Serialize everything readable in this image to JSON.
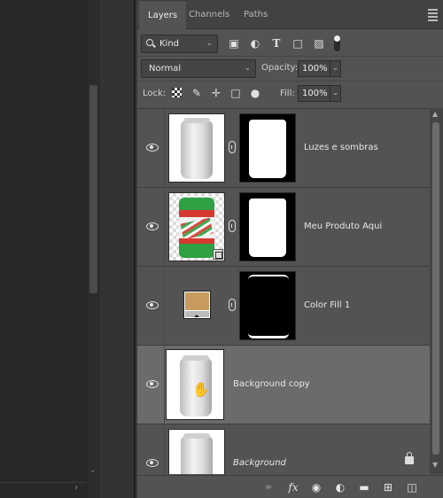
{
  "tabs": [
    {
      "label": "Layers",
      "active": true
    },
    {
      "label": "Channels",
      "active": false
    },
    {
      "label": "Paths",
      "active": false
    }
  ],
  "filter": {
    "kind_label": "Kind",
    "icons": [
      "pixel-filter-icon",
      "adjustment-filter-icon",
      "type-filter-icon",
      "shape-filter-icon",
      "smart-object-filter-icon",
      "filter-toggle-icon"
    ]
  },
  "blend": {
    "mode": "Normal",
    "opacity_label": "Opacity:",
    "opacity_value": "100%"
  },
  "lock": {
    "label": "Lock:",
    "fill_label": "Fill:",
    "fill_value": "100%"
  },
  "layers": [
    {
      "name": "Luzes e sombras",
      "visible": true,
      "italic": false,
      "selected": false,
      "thumbnail": "can-icon",
      "mask": "can-mask"
    },
    {
      "name": "Meu Produto Aqui",
      "visible": true,
      "italic": false,
      "selected": false,
      "thumbnail": "product-can-icon",
      "mask": "can-mask"
    },
    {
      "name": "Color Fill 1",
      "visible": true,
      "italic": false,
      "selected": false,
      "thumbnail": "color-fill-icon",
      "mask": "inverted-can-mask",
      "fill_color": "#c79a5e"
    },
    {
      "name": "Background copy",
      "visible": true,
      "italic": false,
      "selected": true,
      "thumbnail": "can-icon"
    },
    {
      "name": "Background",
      "visible": true,
      "italic": true,
      "selected": false,
      "thumbnail": "can-icon",
      "locked": true
    }
  ],
  "footer_icons": [
    "link-layers-icon",
    "fx-icon",
    "add-mask-icon",
    "adjustment-layer-icon",
    "new-group-icon",
    "new-layer-icon",
    "delete-icon"
  ],
  "colors": {
    "panel": "#535353",
    "selected_row": "#6b6b6b",
    "tab_bar": "#424242"
  }
}
